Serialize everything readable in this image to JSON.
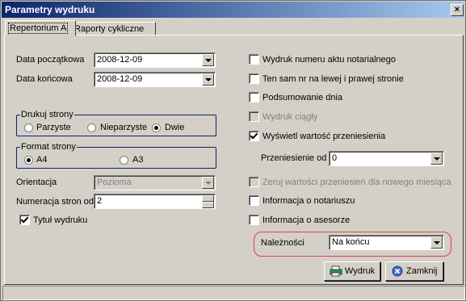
{
  "window": {
    "title": "Parametry wydruku",
    "close_label": "×"
  },
  "tabs": [
    {
      "label": "Repertorium A",
      "active": true
    },
    {
      "label": "Raporty cykliczne",
      "active": false
    }
  ],
  "left": {
    "date_from": {
      "label": "Data początkowa",
      "value": "2008-12-09"
    },
    "date_to": {
      "label": "Data końcowa",
      "value": "2008-12-09"
    },
    "print_pages": {
      "title": "Drukuj strony",
      "options": [
        "Parzyste",
        "Nieparzyste",
        "Dwie"
      ],
      "selected": "Dwie"
    },
    "page_format": {
      "title": "Format strony",
      "options": [
        "A4",
        "A3"
      ],
      "selected": "A4"
    },
    "orientation": {
      "label": "Orientacja",
      "value": "Pozioma",
      "enabled": false
    },
    "page_numbering": {
      "label": "Numeracja stron od",
      "value": "2"
    },
    "print_title": {
      "label": "Tytuł wydruku",
      "checked": true
    }
  },
  "right": {
    "checkboxes": [
      {
        "label": "Wydruk numeru aktu notarialnego",
        "checked": false,
        "enabled": true
      },
      {
        "label": "Ten sam nr na lewej i prawej stronie",
        "checked": false,
        "enabled": true
      },
      {
        "label": "Podsumowanie dnia",
        "checked": false,
        "enabled": true
      },
      {
        "label": "Wydruk ciągły",
        "checked": false,
        "enabled": false
      },
      {
        "label": "Wyświetl wartość przeniesienia",
        "checked": true,
        "enabled": true
      }
    ],
    "transfer_from": {
      "label": "Przeniesienie od",
      "value": "0"
    },
    "checkboxes2": [
      {
        "label": "Zeruj wartości przeniesień dla nowego miesiąca",
        "checked": false,
        "enabled": false
      },
      {
        "label": "Informacja o notariuszu",
        "checked": false,
        "enabled": true
      },
      {
        "label": "Informacja o asesorze",
        "checked": false,
        "enabled": true
      }
    ],
    "fees": {
      "label": "Należności",
      "value": "Na końcu"
    }
  },
  "buttons": {
    "print": "Wydruk",
    "close": "Zamknij"
  },
  "colors": {
    "title_start": "#0a246a",
    "title_end": "#a6caf0",
    "highlight": "#e0404a",
    "face": "#d4d0c8"
  }
}
